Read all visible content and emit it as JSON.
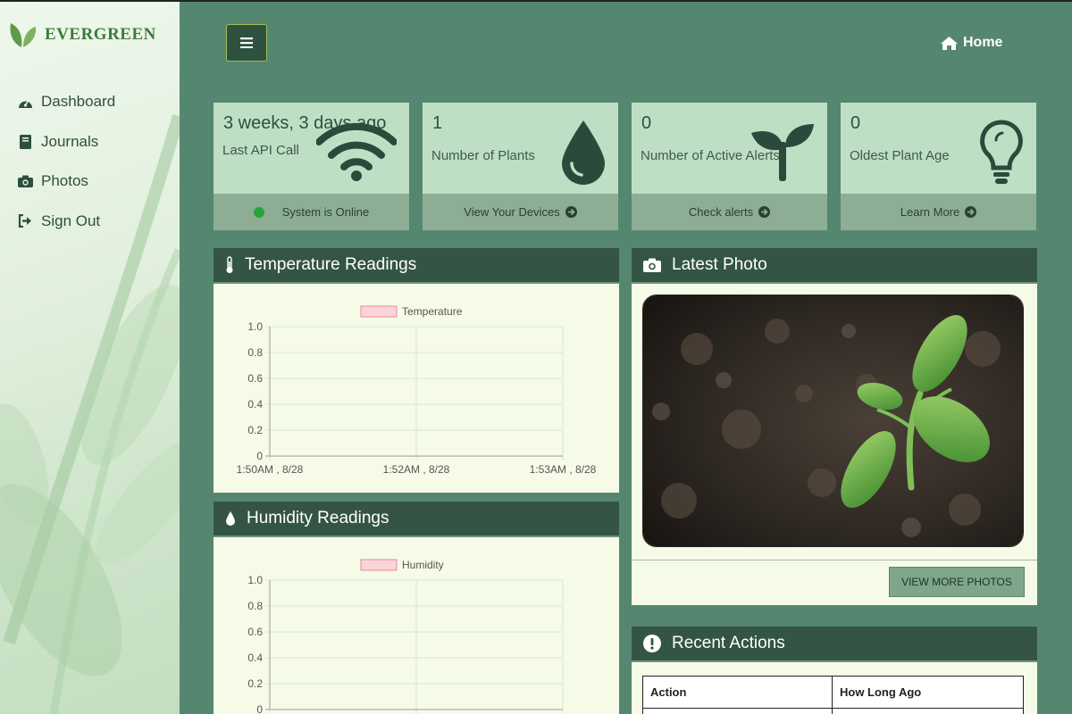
{
  "brand": {
    "name": "EVERGREEN"
  },
  "sidebar": {
    "items": [
      {
        "label": "Dashboard",
        "icon": "dashboard-icon"
      },
      {
        "label": "Journals",
        "icon": "book-icon"
      },
      {
        "label": "Photos",
        "icon": "camera-icon"
      },
      {
        "label": "Sign Out",
        "icon": "sign-out-icon"
      }
    ]
  },
  "header": {
    "home_label": "Home"
  },
  "cards": [
    {
      "value": "3 weeks, 3 days ago",
      "label": "Last API Call",
      "footer": "System is Online",
      "icon": "wifi-icon"
    },
    {
      "value": "1",
      "label": "Number of Plants",
      "footer": "View Your Devices",
      "icon": "water-drop-icon"
    },
    {
      "value": "0",
      "label": "Number of Active Alerts",
      "footer": "Check alerts",
      "icon": "seedling-icon"
    },
    {
      "value": "0",
      "label": "Oldest Plant Age",
      "footer": "Learn More",
      "icon": "lightbulb-icon"
    }
  ],
  "temperature_panel": {
    "title": "Temperature Readings"
  },
  "humidity_panel": {
    "title": "Humidity Readings"
  },
  "photo_panel": {
    "title": "Latest Photo",
    "button": "VIEW MORE PHOTOS"
  },
  "actions_panel": {
    "title": "Recent Actions",
    "columns": [
      "Action",
      "How Long Ago"
    ]
  },
  "colors": {
    "sidebar_bg": "#e2f0dd",
    "main_bg": "#558770",
    "panel_header": "#345445",
    "card_bg": "#bfdfc5",
    "status_online": "#2aa13a"
  },
  "chart_data": [
    {
      "type": "line",
      "title": "",
      "series": [
        {
          "name": "Temperature",
          "values": []
        }
      ],
      "x_ticks": [
        "1:50AM , 8/28",
        "1:52AM , 8/28",
        "1:53AM , 8/28"
      ],
      "y_ticks": [
        0,
        0.2,
        0.4,
        0.6,
        0.8,
        1.0
      ],
      "ylim": [
        0,
        1.0
      ],
      "legend": "top",
      "grid": true
    },
    {
      "type": "line",
      "title": "",
      "series": [
        {
          "name": "Humidity",
          "values": []
        }
      ],
      "y_ticks": [
        0,
        0.2,
        0.4,
        0.6,
        0.8,
        1.0
      ],
      "ylim": [
        0,
        1.0
      ],
      "legend": "top",
      "grid": true
    }
  ]
}
